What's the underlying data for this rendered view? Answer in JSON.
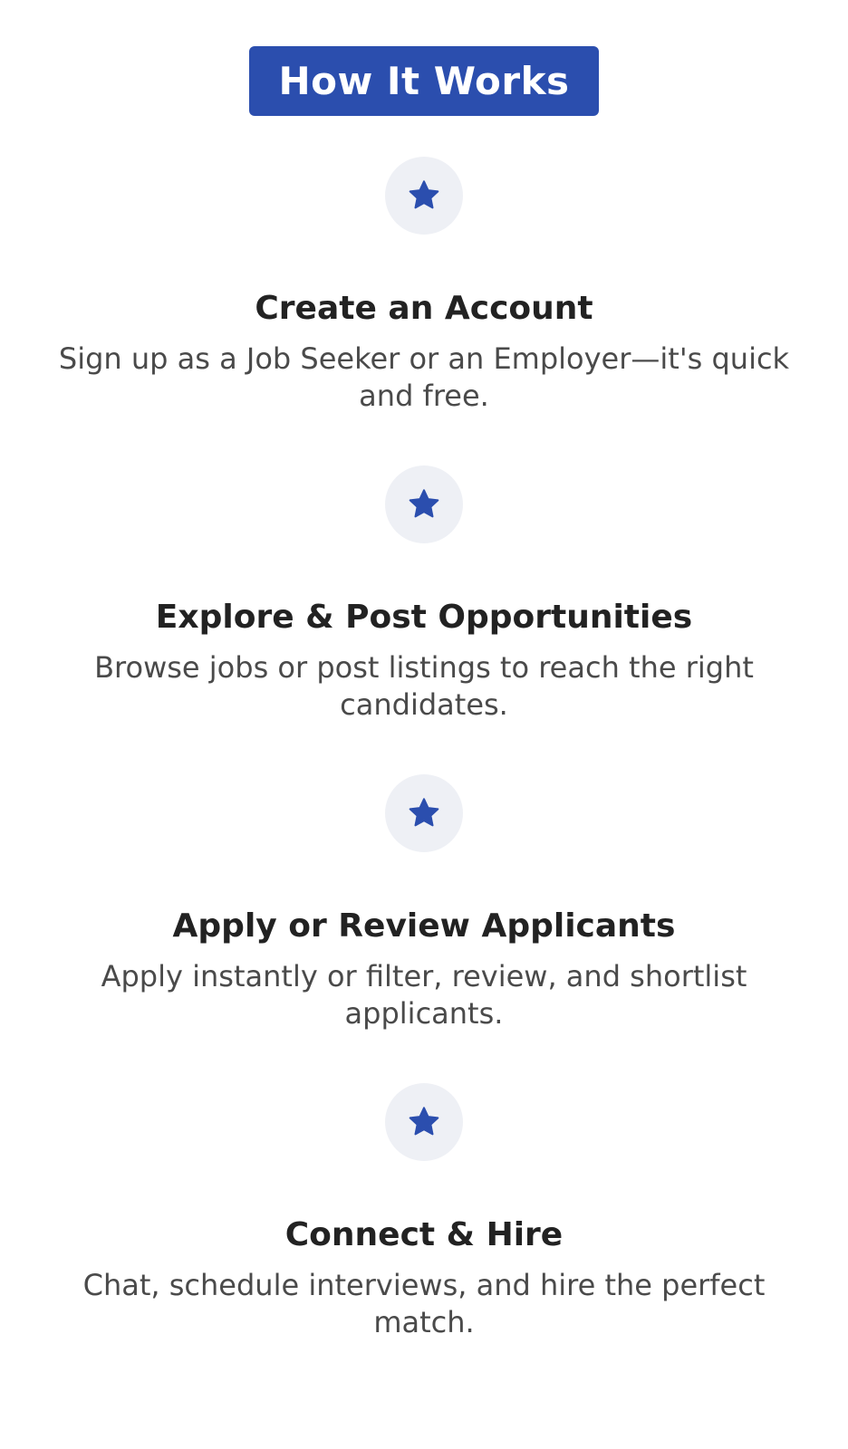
{
  "header": {
    "title": "How It Works"
  },
  "colors": {
    "accent": "#2b4eae",
    "icon_bg": "#eef0f5",
    "title_text": "#222222",
    "desc_text": "#4a4a4a"
  },
  "steps": [
    {
      "icon": "star-icon",
      "title": "Create an Account",
      "description": "Sign up as a Job Seeker or an Employer—it's quick and free."
    },
    {
      "icon": "star-icon",
      "title": "Explore & Post Opportunities",
      "description": "Browse jobs or post listings to reach the right candidates."
    },
    {
      "icon": "star-icon",
      "title": "Apply or Review Applicants",
      "description": "Apply instantly or filter, review, and shortlist applicants."
    },
    {
      "icon": "star-icon",
      "title": "Connect & Hire",
      "description": "Chat, schedule interviews, and hire the perfect match."
    }
  ]
}
